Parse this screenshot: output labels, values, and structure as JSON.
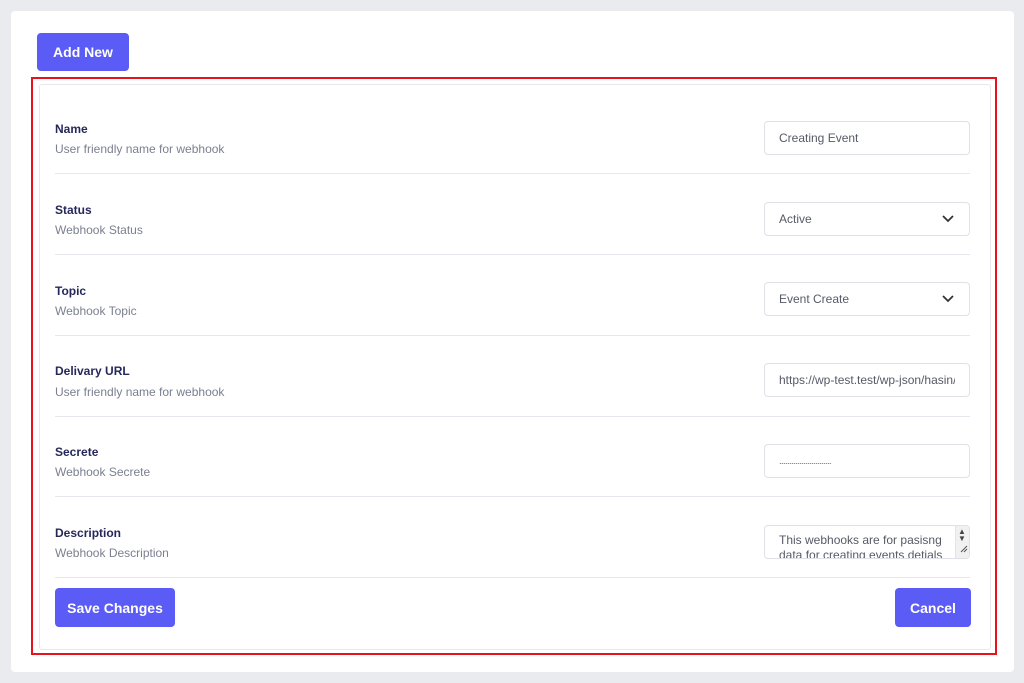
{
  "header": {
    "add_new_label": "Add New"
  },
  "form": {
    "fields": [
      {
        "label": "Name",
        "description": "User friendly name for webhook",
        "value": "Creating Event",
        "type": "text"
      },
      {
        "label": "Status",
        "description": "Webhook Status",
        "value": "Active",
        "type": "select"
      },
      {
        "label": "Topic",
        "description": "Webhook Topic",
        "value": "Event Create",
        "type": "select"
      },
      {
        "label": "Delivary URL",
        "description": "User friendly name for webhook",
        "value": "https://wp-test.test/wp-json/hasin/v",
        "type": "text"
      },
      {
        "label": "Secrete",
        "description": "Webhook Secrete",
        "value": "..........................",
        "type": "password"
      },
      {
        "label": "Description",
        "description": "Webhook Description",
        "value": "This webhooks are for pasisng data for creating events detials",
        "type": "textarea"
      }
    ]
  },
  "actions": {
    "save_label": "Save Changes",
    "cancel_label": "Cancel"
  },
  "colors": {
    "accent": "#5b5bf6",
    "highlight_border": "#e8121a",
    "label": "#26285a",
    "muted": "#7b7f8f"
  },
  "icons": {
    "select_arrow": "chevron-down-icon"
  }
}
